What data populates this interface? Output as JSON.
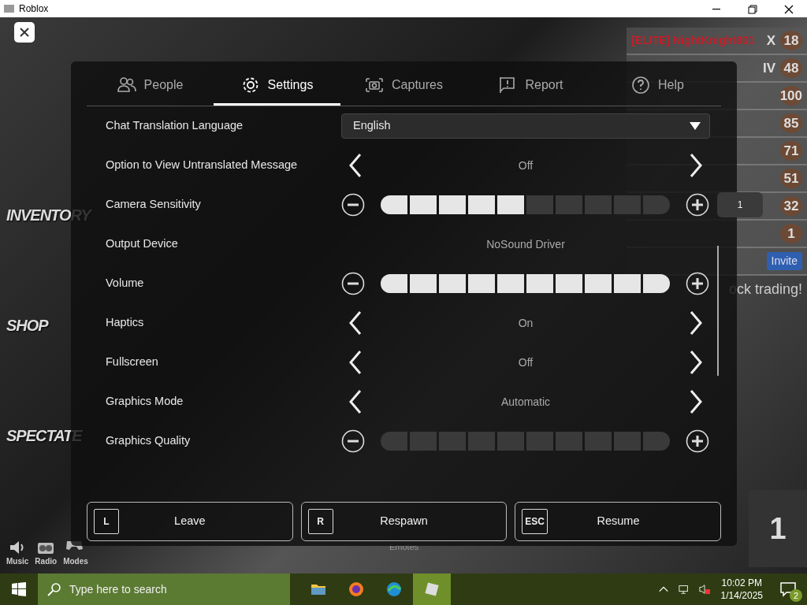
{
  "window": {
    "title": "Roblox"
  },
  "leaderboard": {
    "rows": [
      {
        "name": "[ELITE] NightKnight801",
        "rank": "X",
        "score": "18"
      },
      {
        "rank": "IV",
        "score": "48"
      },
      {
        "score": "100"
      },
      {
        "score": "85"
      },
      {
        "score": "71"
      },
      {
        "score": "51"
      },
      {
        "score": "32"
      },
      {
        "score": "1"
      }
    ],
    "invite": "Invite",
    "banner_text": "ock trading!"
  },
  "hud": {
    "left_buttons": [
      "INVENTORY",
      "SHOP",
      "SPECTATE"
    ],
    "bottom_buttons": [
      "Music",
      "Radio",
      "Modes"
    ],
    "corner_number": "1",
    "emotes": "Emotes"
  },
  "menu": {
    "tabs": [
      {
        "label": "People",
        "selected": false
      },
      {
        "label": "Settings",
        "selected": true
      },
      {
        "label": "Captures",
        "selected": false
      },
      {
        "label": "Report",
        "selected": false
      },
      {
        "label": "Help",
        "selected": false
      }
    ],
    "settings": [
      {
        "kind": "dropdown",
        "label": "Chat Translation Language",
        "value": "English"
      },
      {
        "kind": "selector",
        "label": "Option to View Untranslated Message",
        "value": "Off"
      },
      {
        "kind": "slider",
        "label": "Camera Sensitivity",
        "level": 0.5,
        "input": "1"
      },
      {
        "kind": "text",
        "label": "Output Device",
        "value": "NoSound Driver"
      },
      {
        "kind": "slider",
        "label": "Volume",
        "level": 1
      },
      {
        "kind": "selector",
        "label": "Haptics",
        "value": "On"
      },
      {
        "kind": "selector",
        "label": "Fullscreen",
        "value": "Off"
      },
      {
        "kind": "selector",
        "label": "Graphics Mode",
        "value": "Automatic"
      },
      {
        "kind": "slider",
        "label": "Graphics Quality",
        "level": 0
      }
    ],
    "buttons": [
      {
        "key": "L",
        "label": "Leave"
      },
      {
        "key": "R",
        "label": "Respawn"
      },
      {
        "key": "ESC",
        "label": "Resume"
      }
    ]
  },
  "taskbar": {
    "search": {
      "placeholder": "Type here to search"
    },
    "time": "10:02 PM",
    "date": "1/14/2025",
    "notifications": "2"
  }
}
